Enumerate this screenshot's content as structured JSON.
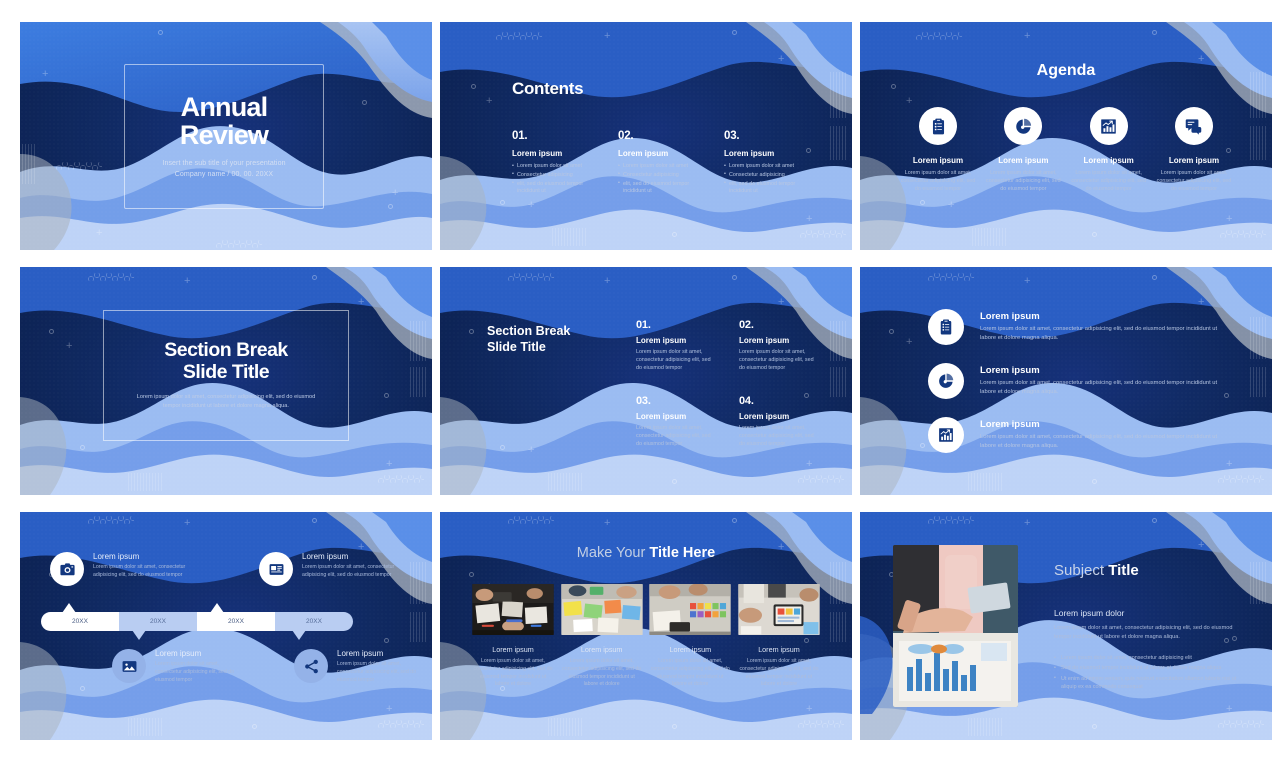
{
  "theme": {
    "deep_navy": "#0b1f4d",
    "navy": "#102a63",
    "mid_blue": "#16317a",
    "accent_blue": "#2f6ae0",
    "light_blue": "#b9cdf2",
    "pale_blue": "#94b2e8",
    "gray_wave": "#9aa3ad",
    "white": "#ffffff"
  },
  "slides": [
    {
      "id": "title-slide",
      "name": "Annual Review Title Slide",
      "title_line1": "Annual",
      "title_line2": "Review",
      "subtitle_line1": "Insert the sub title of your presentation",
      "subtitle_line2": "Company name  /  00. 00. 20XX"
    },
    {
      "id": "contents-slide",
      "name": "Contents Slide",
      "heading": "Contents",
      "columns": [
        {
          "number": "01.",
          "subhead": "Lorem ipsum",
          "bullets": [
            "Lorem ipsum dolor sit amet",
            "Consectetur adipisicing",
            "elit, sed do eiusmod tempor incididunt ut"
          ]
        },
        {
          "number": "02.",
          "subhead": "Lorem ipsum",
          "bullets": [
            "Lorem ipsum dolor sit amet",
            "Consectetur adipisicing",
            "elit, sed do eiusmod tempor incididunt ut"
          ]
        },
        {
          "number": "03.",
          "subhead": "Lorem ipsum",
          "bullets": [
            "Lorem ipsum dolor sit amet",
            "Consectetur adipisicing",
            "elit, sed do eiusmod tempor incididunt ut"
          ]
        }
      ]
    },
    {
      "id": "agenda-slide",
      "name": "Agenda Slide",
      "heading": "Agenda",
      "items": [
        {
          "icon": "clipboard-checklist-icon",
          "label": "Lorem ipsum",
          "desc": "Lorem ipsum dolor sit amet, consectetur adipisicing elit, sed do eiusmod tempor"
        },
        {
          "icon": "pie-chart-icon",
          "label": "Lorem ipsum",
          "desc": "Lorem ipsum dolor sit amet, consectetur adipisicing elit, sed do eiusmod tempor"
        },
        {
          "icon": "bar-chart-growth-icon",
          "label": "Lorem ipsum",
          "desc": "Lorem ipsum dolor sit amet, consectetur adipisicing elit, sed do eiusmod tempor"
        },
        {
          "icon": "chat-bubble-icon",
          "label": "Lorem ipsum",
          "desc": "Lorem ipsum dolor sit amet, consectetur adipisicing elit, sed do eiusmod tempor"
        }
      ]
    },
    {
      "id": "section-break-slide",
      "name": "Section Break Slide",
      "title_line1": "Section Break",
      "title_line2": "Slide Title",
      "desc": "Lorem ipsum dolor sit amet, consectetur adipisicing elit, sed do eiusmod tempor incididunt ut labore et dolore magna aliqua."
    },
    {
      "id": "section-break-items-slide",
      "name": "Section Break With Four Items",
      "title_line1": "Section Break",
      "title_line2": "Slide Title",
      "items": [
        {
          "number": "01.",
          "subhead": "Lorem ipsum",
          "desc": "Lorem ipsum dolor sit amet, consectetur adipisicing elit, sed do eiusmod tempor"
        },
        {
          "number": "02.",
          "subhead": "Lorem ipsum",
          "desc": "Lorem ipsum dolor sit amet, consectetur adipisicing elit, sed do eiusmod tempor"
        },
        {
          "number": "03.",
          "subhead": "Lorem ipsum",
          "desc": "Lorem ipsum dolor sit amet, consectetur adipisicing elit, sed do eiusmod tempor"
        },
        {
          "number": "04.",
          "subhead": "Lorem ipsum",
          "desc": "Lorem ipsum dolor sit amet, consectetur adipisicing elit, sed do eiusmod tempor"
        }
      ]
    },
    {
      "id": "icon-list-slide",
      "name": "Three Icon List Slide",
      "items": [
        {
          "icon": "clipboard-checklist-icon",
          "head": "Lorem ipsum",
          "desc": "Lorem ipsum dolor sit amet, consectetur adipisicing elit, sed do eiusmod tempor incididunt ut labore et dolore magna aliqua."
        },
        {
          "icon": "pie-chart-icon",
          "head": "Lorem ipsum",
          "desc": "Lorem ipsum dolor sit amet, consectetur adipisicing elit, sed do eiusmod tempor incididunt ut labore et dolore magna aliqua."
        },
        {
          "icon": "bar-chart-growth-icon",
          "head": "Lorem ipsum",
          "desc": "Lorem ipsum dolor sit amet, consectetur adipisicing elit, sed do eiusmod tempor incididunt ut labore et dolore magna aliqua."
        }
      ]
    },
    {
      "id": "timeline-slide",
      "name": "Timeline Slide",
      "timeline_labels": [
        "20XX",
        "20XX",
        "20XX",
        "20XX"
      ],
      "top_items": [
        {
          "icon": "camera-icon",
          "head": "Lorem ipsum",
          "desc": "Lorem ipsum dolor sit amet, consectetur adipisicing elit, sed do eiusmod tempor"
        },
        {
          "icon": "news-article-icon",
          "head": "Lorem ipsum",
          "desc": "Lorem ipsum dolor sit amet, consectetur adipisicing elit, sed do eiusmod tempor"
        }
      ],
      "bottom_items": [
        {
          "icon": "image-picture-icon",
          "head": "Lorem ipsum",
          "desc": "Lorem ipsum dolor sit amet, consectetur adipisicing elit, sed do eiusmod tempor"
        },
        {
          "icon": "share-network-icon",
          "head": "Lorem ipsum",
          "desc": "Lorem ipsum dolor sit amet, consectetur adipisicing elit, sed do eiusmod tempor"
        }
      ]
    },
    {
      "id": "photo-grid-slide",
      "name": "Photo Grid Slide",
      "heading_normal": "Make Your ",
      "heading_bold": "Title Here",
      "cards": [
        {
          "photo": "team-desk-sketching-photo",
          "caption": "Lorem ipsum",
          "text": "Lorem ipsum dolor sit amet, consectetur adipisicing elit, sed do eiusmod tempor incididunt ut labore et dolore"
        },
        {
          "photo": "colorful-paper-workshop-photo",
          "caption": "Lorem ipsum",
          "text": "Lorem ipsum dolor sit amet, consectetur adipisicing elit, sed do eiusmod tempor incididunt ut labore et dolore"
        },
        {
          "photo": "sticky-notes-planning-photo",
          "caption": "Lorem ipsum",
          "text": "Lorem ipsum dolor sit amet, consectetur adipisicing elit, sed do eiusmod tempor incididunt ut labore et dolore"
        },
        {
          "photo": "tablet-design-review-photo",
          "caption": "Lorem ipsum",
          "text": "Lorem ipsum dolor sit amet, consectetur adipisicing elit, sed do eiusmod tempor incididunt ut labore et dolore"
        }
      ]
    },
    {
      "id": "subject-title-slide",
      "name": "Subject Title Slide",
      "photo": "people-reviewing-charts-photo",
      "title_normal": "Subject ",
      "title_bold": "Title",
      "subhead": "Lorem ipsum dolor",
      "paragraph": "Lorem ipsum dolor sit amet, consectetur adipisicing elit, sed do eiusmod tempor incididunt ut labore et dolore magna aliqua.",
      "bullets": [
        "Lorem ipsum dolor sit amet, consectetur adipisicing elit",
        "Sed do eiusmod tempor incididunt ut labore et dolore magna aliqua",
        "Ut enim ad minim veniam, quis nostrud exercitation ullamco laboris nisi ut aliquip ex ea commodo consequat"
      ]
    }
  ]
}
